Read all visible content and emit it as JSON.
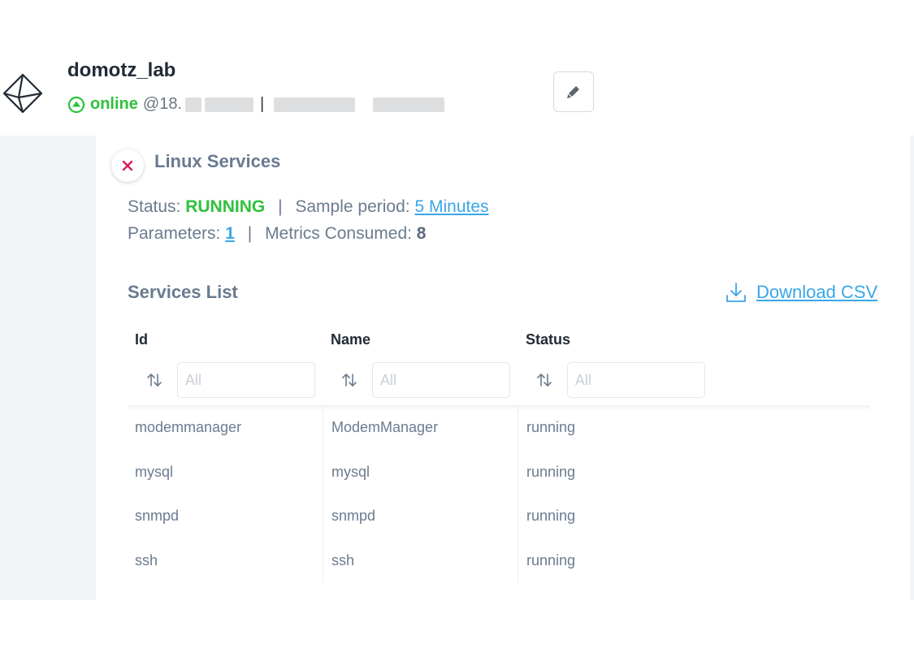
{
  "header": {
    "agent_name": "domotz_lab",
    "status": "online",
    "ip_prefix": "@18."
  },
  "panel": {
    "title": "Linux Services",
    "status_label": "Status:",
    "status_value": "RUNNING",
    "sample_label": "Sample period:",
    "sample_value": "5 Minutes",
    "params_label": "Parameters:",
    "params_value": "1",
    "metrics_label": "Metrics Consumed:",
    "metrics_value": "8",
    "separator": "|"
  },
  "services": {
    "title": "Services List",
    "download_label": "Download CSV",
    "columns": [
      {
        "label": "Id",
        "placeholder": "All"
      },
      {
        "label": "Name",
        "placeholder": "All"
      },
      {
        "label": "Status",
        "placeholder": "All"
      }
    ],
    "rows": [
      {
        "id": "modemmanager",
        "name": "ModemManager",
        "status": "running"
      },
      {
        "id": "mysql",
        "name": "mysql",
        "status": "running"
      },
      {
        "id": "snmpd",
        "name": "snmpd",
        "status": "running"
      },
      {
        "id": "ssh",
        "name": "ssh",
        "status": "running"
      }
    ]
  },
  "icons": {
    "logo": "domotz-diamond-logo",
    "status": "online-up-arrow-icon",
    "edit": "pencil-icon",
    "close": "close-icon",
    "download": "download-icon",
    "sort": "sort-icon"
  },
  "colors": {
    "online": "#2ec13c",
    "link": "#3aa6e8",
    "close": "#d81b60",
    "text": "#6b7b90"
  }
}
